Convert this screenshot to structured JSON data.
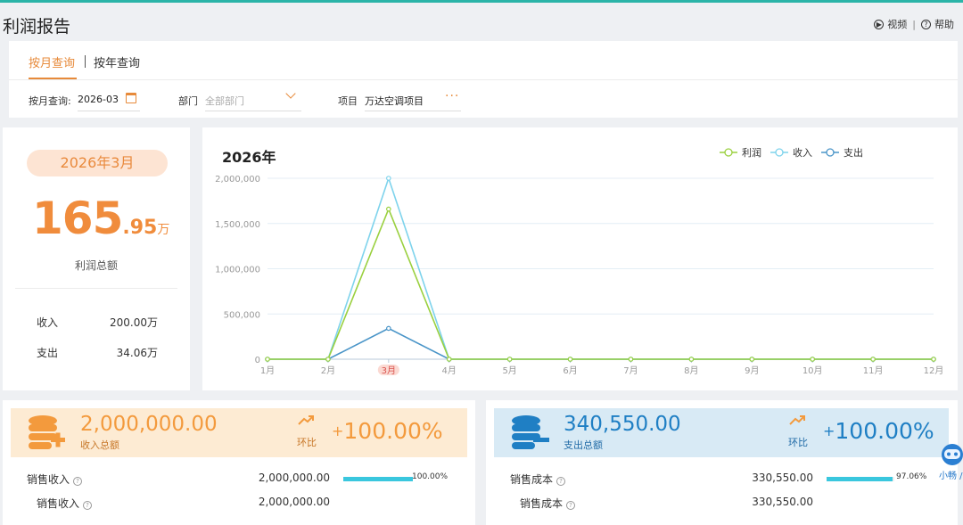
{
  "page": {
    "title": "利润报告"
  },
  "header_links": {
    "video": "视频",
    "help": "帮助",
    "separator": "|"
  },
  "tabs": [
    {
      "label": "按月查询",
      "active": true
    },
    {
      "label": "按年查询",
      "active": false
    }
  ],
  "filters": {
    "month": {
      "label": "按月查询:",
      "value": "2026-03"
    },
    "department": {
      "label": "部门",
      "placeholder": "全部部门"
    },
    "project": {
      "label": "项目",
      "value": "万达空调项目"
    }
  },
  "summary": {
    "month_pill": "2026年3月",
    "profit_int": "165",
    "profit_dec": ".95",
    "profit_unit": "万",
    "profit_label": "利润总额",
    "income_label": "收入",
    "income_value": "200.00万",
    "expense_label": "支出",
    "expense_value": "34.06万"
  },
  "chart_data": {
    "type": "line",
    "title": "2026年",
    "categories": [
      "1月",
      "2月",
      "3月",
      "4月",
      "5月",
      "6月",
      "7月",
      "8月",
      "9月",
      "10月",
      "11月",
      "12月"
    ],
    "highlight_category": "3月",
    "series": [
      {
        "name": "利润",
        "color": "#9ad03f",
        "values": [
          0,
          0,
          1659450,
          0,
          0,
          0,
          0,
          0,
          0,
          0,
          0,
          0
        ]
      },
      {
        "name": "收入",
        "color": "#7ed3ec",
        "values": [
          0,
          0,
          2000000,
          0,
          0,
          0,
          0,
          0,
          0,
          0,
          0,
          0
        ]
      },
      {
        "name": "支出",
        "color": "#4a95c8",
        "values": [
          0,
          0,
          340550,
          0,
          0,
          0,
          0,
          0,
          0,
          0,
          0,
          0
        ]
      }
    ],
    "ylim": [
      0,
      2000000
    ],
    "yticks": [
      0,
      500000,
      1000000,
      1500000,
      2000000
    ],
    "ytick_labels": [
      "0",
      "500,000",
      "1,000,000",
      "1,500,000",
      "2,000,000"
    ],
    "grid": true,
    "legend_position": "top-right"
  },
  "income_card": {
    "amount": "2,000,000.00",
    "amount_label": "收入总额",
    "ratio_label": "环比",
    "ratio_sign": "+",
    "ratio": "100.00%",
    "accent": "#f39a3d",
    "items": [
      {
        "name": "销售收入",
        "amount": "2,000,000.00",
        "percent": 100.0,
        "percent_label": "100.00%"
      },
      {
        "name": "销售收入",
        "amount": "2,000,000.00"
      }
    ]
  },
  "expense_card": {
    "amount": "340,550.00",
    "amount_label": "支出总额",
    "ratio_label": "环比",
    "ratio_sign": "+",
    "ratio": "100.00%",
    "accent": "#1f7fc4",
    "items": [
      {
        "name": "销售成本",
        "amount": "330,550.00",
        "percent": 97.06,
        "percent_label": "97.06%"
      },
      {
        "name": "销售成本",
        "amount": "330,550.00"
      }
    ]
  },
  "assistant": {
    "label": "小畅 /"
  }
}
